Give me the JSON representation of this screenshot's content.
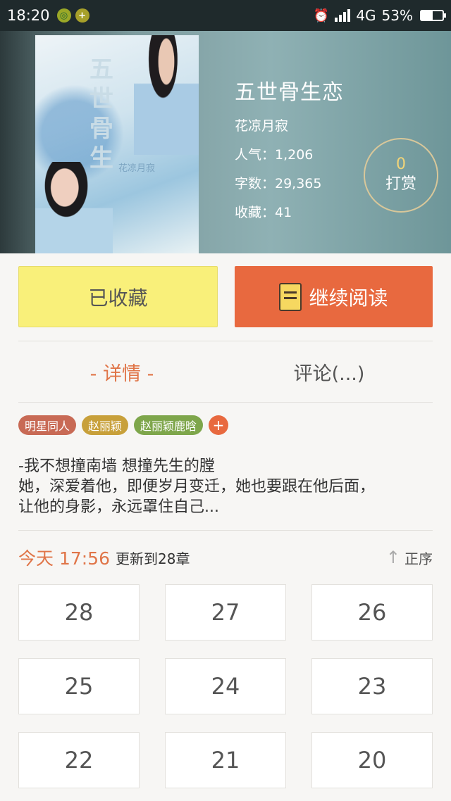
{
  "status_bar": {
    "time": "18:20",
    "network": "4G",
    "battery_percent": "53%",
    "battery_level": 0.53
  },
  "book": {
    "cover_title": "五世骨生",
    "cover_signature": "花凉月寂",
    "title": "五世骨生恋",
    "author": "花凉月寂",
    "popularity": "人气：1,206",
    "word_count": "字数：29,365",
    "favorites": "收藏：41"
  },
  "tip": {
    "count": "0",
    "label": "打赏"
  },
  "actions": {
    "collected_label": "已收藏",
    "continue_label": "继续阅读"
  },
  "tabs": {
    "detail": "- 详情 -",
    "comments": "评论(...)"
  },
  "tags": [
    {
      "label": "明星同人",
      "color": "#c86a55"
    },
    {
      "label": "赵丽颖",
      "color": "#c8a03a"
    },
    {
      "label": "赵丽颖鹿晗",
      "color": "#7ea64b"
    }
  ],
  "tag_add": "+",
  "description": {
    "line1": "-我不想撞南墙 想撞先生的膛",
    "line2": "她，深爱着他，即便岁月变迁，她也要跟在他后面，",
    "line3": "让他的身影，永远罩住自己..."
  },
  "update": {
    "today": "今天 17:56",
    "text": "更新到28章",
    "sort_label": "正序"
  },
  "chapters": [
    "28",
    "27",
    "26",
    "25",
    "24",
    "23",
    "22",
    "21",
    "20"
  ]
}
